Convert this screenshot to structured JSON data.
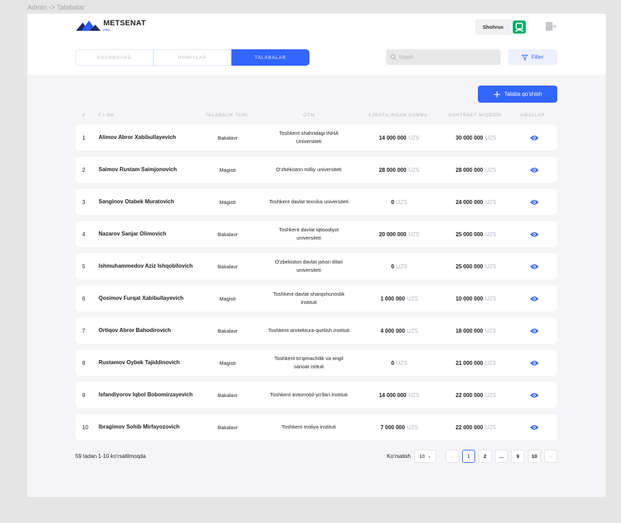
{
  "breadcrumb": "Admin -> Talabalar",
  "brand": {
    "name": "METSENAT",
    "badge": "PRO"
  },
  "user": {
    "name": "Shohrux"
  },
  "tabs": [
    {
      "label": "DASHBOARD",
      "active": false
    },
    {
      "label": "HOMIYLAR",
      "active": false
    },
    {
      "label": "TALABALAR",
      "active": true
    }
  ],
  "search": {
    "placeholder": "Izlash"
  },
  "filter_label": "Filter",
  "add_button": "Talaba qo'shish",
  "columns": [
    "#",
    "F.I.SH.",
    "Talabalik turi",
    "OTM",
    "Ajratilingan summa",
    "Kontrakt miqdori",
    "Amallar"
  ],
  "currency": "UZS",
  "rows": [
    {
      "num": "1",
      "name": "Alimov Abror Xabibullayevich",
      "type": "Bakalavr",
      "otm": "Toshkent shahridagi INHA Universiteti",
      "allocated": "14 000 000",
      "contract": "30 000 000"
    },
    {
      "num": "2",
      "name": "Saimov Rustam Saimjonovich",
      "type": "Magistr",
      "otm": "O'zbekiston milliy universiteti",
      "allocated": "28 000 000",
      "contract": "28 000 000"
    },
    {
      "num": "3",
      "name": "Sanginov Otabek Muratovich",
      "type": "Magistr",
      "otm": "Toshkent davlat texnika universiteti",
      "allocated": "0",
      "contract": "24 000 000"
    },
    {
      "num": "4",
      "name": "Nazarov Sanjar Olimovich",
      "type": "Bakalavr",
      "otm": "Toshkent davlat iqtisodiyot universiteti",
      "allocated": "20 000 000",
      "contract": "25 000 000"
    },
    {
      "num": "5",
      "name": "Ishmuhammedov Aziz Ishqobilovich",
      "type": "Bakalavr",
      "otm": "O'zbekiston davlat jahon tillari universiteti",
      "allocated": "0",
      "contract": "25 000 000"
    },
    {
      "num": "6",
      "name": "Qosimov Furqat Xabibullayevich",
      "type": "Magistr",
      "otm": "Toshkent davlat sharqshunoslik instituti",
      "allocated": "1 000 000",
      "contract": "10 000 000"
    },
    {
      "num": "7",
      "name": "Ortiqov Abror Bahodirovich",
      "type": "Bakalavr",
      "otm": "Toshkent arxitektura-qurilish instituti",
      "allocated": "4 000 000",
      "contract": "18 000 000"
    },
    {
      "num": "8",
      "name": "Rustamov Oybek Tajiddinovich",
      "type": "Magistr",
      "otm": "Toshkent to'qimachilik va нngil sanoat istituti",
      "allocated": "0",
      "contract": "21 000 000"
    },
    {
      "num": "9",
      "name": "Isfandiyorov  Iqbol Bobomirzayevich",
      "type": "Bakalavr",
      "otm": "Toshkent avtomobil-yo'llari instituti",
      "allocated": "14 000 000",
      "contract": "22 000 000"
    },
    {
      "num": "10",
      "name": "Ibragimov Sohib Mirfayozovich",
      "type": "Bakalavr",
      "otm": "Toshkent moliya instituti",
      "allocated": "7 000 000",
      "contract": "22 000 000"
    }
  ],
  "footer": {
    "summary": "59 tadan  1-10 ko'rsatilmoqda",
    "per_page_label": "Ko'rsatish",
    "per_page_value": "10",
    "pages": [
      "1",
      "2",
      "...",
      "9",
      "10"
    ],
    "current_page": "1"
  },
  "colors": {
    "accent": "#3366ff",
    "avatar": "#00ae69",
    "muted": "#b2b7c1"
  },
  "icons": [
    "metsenat-logo-icon",
    "avatar-icon",
    "logout-icon",
    "search-icon",
    "filter-icon",
    "plus-icon",
    "eye-icon",
    "chevron-down-icon",
    "chevron-left-icon",
    "chevron-right-icon"
  ]
}
